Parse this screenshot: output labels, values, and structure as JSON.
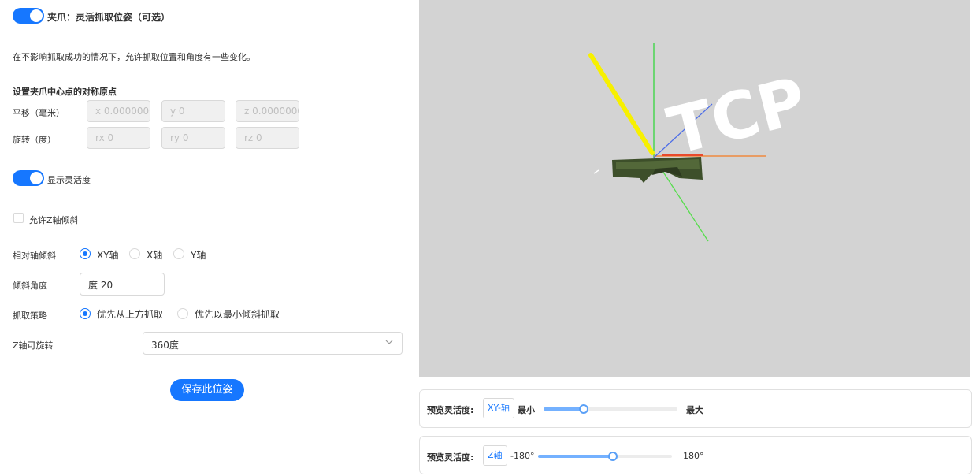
{
  "gripper": {
    "toggle_on": true,
    "title": "夹爪：灵活抓取位姿（可选）",
    "description": "在不影响抓取成功的情况下，允许抓取位置和角度有一些变化。"
  },
  "origin": {
    "heading": "设置夹爪中心点的对称原点",
    "translate_label": "平移（毫米）",
    "rotate_label": "旋转（度）",
    "x": "x 0.00000000",
    "y": "y 0",
    "z": "z 0.00000000",
    "rx": "rx 0",
    "ry": "ry 0",
    "rz": "rz 0"
  },
  "flex": {
    "toggle_on": true,
    "show_label": "显示灵活度",
    "allow_z_tilt_label": "允许Z轴倾斜",
    "allow_z_tilt_checked": false
  },
  "tilt": {
    "relative_axis_label": "相对轴倾斜",
    "options": [
      "XY轴",
      "X轴",
      "Y轴"
    ],
    "selected": "XY轴",
    "angle_label": "倾斜角度",
    "angle_value": "度 20"
  },
  "strategy": {
    "label": "抓取策略",
    "options": [
      "优先从上方抓取",
      "优先以最小倾斜抓取"
    ],
    "selected": "优先从上方抓取"
  },
  "z_rotate": {
    "label": "Z轴可旋转",
    "value": "360度"
  },
  "save_button": "保存此位姿",
  "viewport": {
    "tcp_label": "TCP",
    "background": "#d3d3d3"
  },
  "preview_xy": {
    "label": "预览灵活度:",
    "tag": "XY-轴",
    "min": "最小",
    "max": "最大",
    "level": 0.3
  },
  "preview_z": {
    "label": "预览灵活度:",
    "tag": "Z轴",
    "min": "-180°",
    "max": "180°",
    "level": 0.56
  },
  "colors": {
    "accent": "#1677ff",
    "slider_fill": "#74b1ff"
  }
}
